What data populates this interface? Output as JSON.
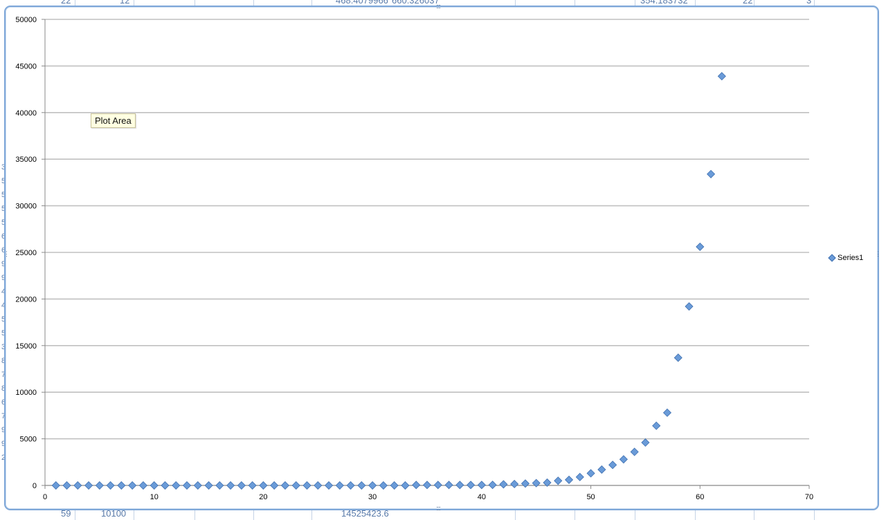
{
  "sheet": {
    "top_cells": [
      "22",
      "12",
      "468.4079966",
      "660.326037",
      "354.183732",
      "22",
      "3"
    ],
    "bottom_cells": [
      "59",
      "10100",
      "14525423.6"
    ],
    "left_row_fragments": [
      "3",
      "5",
      "5",
      "5",
      "5",
      "6",
      "6",
      "9",
      "9",
      "4",
      "4",
      "5",
      "5",
      "3",
      "8",
      "7",
      "8",
      "6",
      "7",
      "9",
      "9",
      "2"
    ]
  },
  "chart": {
    "tooltip": "Plot Area",
    "legend_label": "Series1",
    "marker_color": "#6a9bd8",
    "marker_border": "#3f70b0",
    "gridline_color": "#c0c0c0"
  },
  "chart_data": {
    "type": "scatter",
    "title": "",
    "xlabel": "",
    "ylabel": "",
    "xlim": [
      0,
      70
    ],
    "ylim": [
      0,
      50000
    ],
    "x_ticks": [
      0,
      10,
      20,
      30,
      40,
      50,
      60,
      70
    ],
    "y_ticks": [
      0,
      5000,
      10000,
      15000,
      20000,
      25000,
      30000,
      35000,
      40000,
      45000,
      50000
    ],
    "grid": "horizontal",
    "legend_position": "right",
    "series": [
      {
        "name": "Series1",
        "x": [
          1,
          2,
          3,
          4,
          5,
          6,
          7,
          8,
          9,
          10,
          11,
          12,
          13,
          14,
          15,
          16,
          17,
          18,
          19,
          20,
          21,
          22,
          23,
          24,
          25,
          26,
          27,
          28,
          29,
          30,
          31,
          32,
          33,
          34,
          35,
          36,
          37,
          38,
          39,
          40,
          41,
          42,
          43,
          44,
          45,
          46,
          47,
          48,
          49,
          50,
          51,
          52,
          53,
          54,
          55,
          56,
          57,
          58,
          59,
          60,
          61,
          62
        ],
        "y": [
          0,
          0,
          0,
          0,
          0,
          0,
          0,
          0,
          0,
          0,
          0,
          0,
          0,
          0,
          0,
          0,
          0,
          0,
          0,
          0,
          0,
          0,
          0,
          0,
          0,
          0,
          0,
          0,
          0,
          0,
          0,
          0,
          0,
          50,
          50,
          50,
          50,
          50,
          50,
          50,
          60,
          120,
          150,
          200,
          250,
          300,
          500,
          600,
          900,
          1300,
          1700,
          2200,
          2800,
          3600,
          4600,
          6400,
          7800,
          13700,
          19200,
          25600,
          33400,
          43900
        ]
      }
    ]
  }
}
